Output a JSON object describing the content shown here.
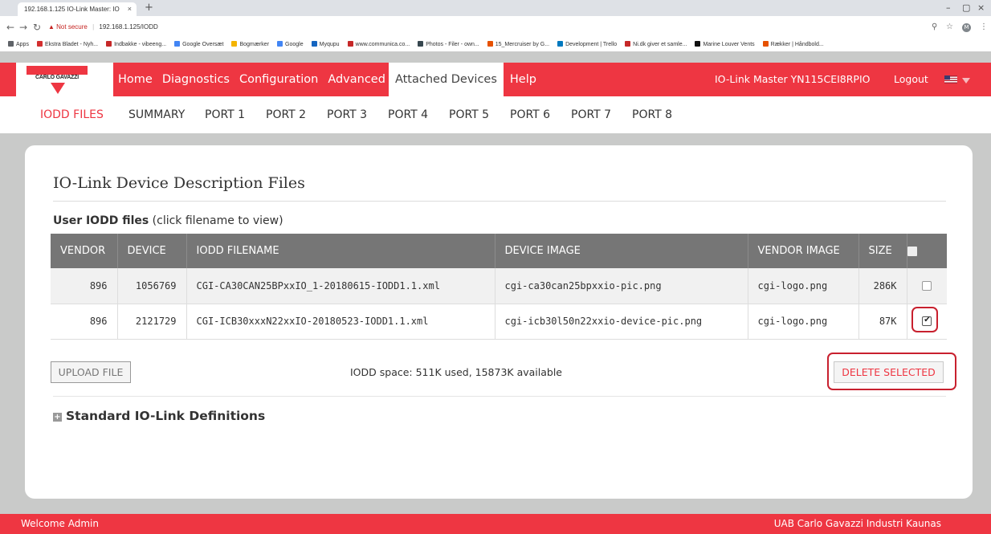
{
  "browser": {
    "tab_title": "192.168.1.125 IO-Link Master: IO",
    "tab_close": "×",
    "new_tab": "+",
    "window_controls": [
      "–",
      "▢",
      "×"
    ],
    "not_secure": "Not secure",
    "url": "192.168.1.125/IODD",
    "bookmarks": [
      {
        "label": "Apps",
        "color": "#5f6368"
      },
      {
        "label": "Ekstra Bladet - Nyh...",
        "color": "#d32f2f"
      },
      {
        "label": "Indbakke - vibeeng...",
        "color": "#c62828"
      },
      {
        "label": "Google Oversæt",
        "color": "#4285f4"
      },
      {
        "label": "Bogmærker",
        "color": "#f4b400"
      },
      {
        "label": "Google",
        "color": "#4285f4"
      },
      {
        "label": "Myqupu",
        "color": "#1565c0"
      },
      {
        "label": "www.communica.co...",
        "color": "#c62828"
      },
      {
        "label": "Photos - Filer - own...",
        "color": "#37474f"
      },
      {
        "label": "15_Mercruiser by G...",
        "color": "#e65100"
      },
      {
        "label": "Development | Trello",
        "color": "#0079bf"
      },
      {
        "label": "Ni.dk giver et samle...",
        "color": "#c62828"
      },
      {
        "label": "Marine Louver Vents",
        "color": "#111"
      },
      {
        "label": "Rækker | Håndbold...",
        "color": "#e65100"
      }
    ],
    "profile_initial": "M"
  },
  "header": {
    "logo_text": "CARLO GAVAZZI",
    "nav": [
      "Home",
      "Diagnostics",
      "Configuration",
      "Advanced",
      "Attached Devices",
      "Help"
    ],
    "active_nav": "Attached Devices",
    "device_name": "IO-Link Master YN115CEI8RPIO",
    "logout": "Logout"
  },
  "subnav": {
    "tabs": [
      "IODD FILES",
      "SUMMARY",
      "PORT 1",
      "PORT 2",
      "PORT 3",
      "PORT 4",
      "PORT 5",
      "PORT 6",
      "PORT 7",
      "PORT 8"
    ],
    "active": "IODD FILES"
  },
  "main": {
    "title": "IO-Link Device Description Files",
    "user_heading_bold": "User IODD files",
    "user_heading_note": " (click filename to view)",
    "table": {
      "headers": [
        "VENDOR",
        "DEVICE",
        "IODD FILENAME",
        "DEVICE IMAGE",
        "VENDOR IMAGE",
        "SIZE"
      ],
      "rows": [
        {
          "vendor": "896",
          "device": "1056769",
          "filename": "CGI-CA30CAN25BPxxIO_1-20180615-IODD1.1.xml",
          "device_image": "cgi-ca30can25bpxxio-pic.png",
          "vendor_image": "cgi-logo.png",
          "size": "286K",
          "checked": false
        },
        {
          "vendor": "896",
          "device": "2121729",
          "filename": "CGI-ICB30xxxN22xxIO-20180523-IODD1.1.xml",
          "device_image": "cgi-icb30l50n22xxio-device-pic.png",
          "vendor_image": "cgi-logo.png",
          "size": "87K",
          "checked": true
        }
      ]
    },
    "upload_button": "UPLOAD FILE",
    "space_info": "IODD space: 511K used, 15873K available",
    "delete_button": "DELETE SELECTED",
    "standard_defs": "Standard IO-Link Definitions"
  },
  "footer": {
    "welcome": "Welcome Admin",
    "company": "UAB Carlo Gavazzi Industri Kaunas"
  }
}
